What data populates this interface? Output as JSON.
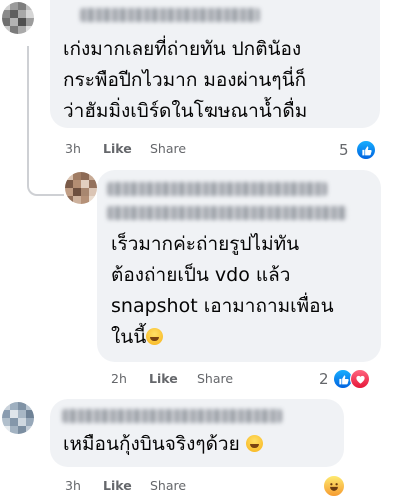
{
  "comments": [
    {
      "text_lines": [
        "เก่งมากเลยที่ถ่ายทัน ปกตินัอง",
        "กระพือปีกไวมาก มองผ่านๆนี่ก็",
        "ว่าฮัมมิ่งเบิร์ดในโฆษณาน้ำดื่ม"
      ],
      "time": "3h",
      "like": "Like",
      "share": "Share",
      "reaction_count": "5",
      "reactions": [
        "like-icon"
      ]
    },
    {
      "text_lines": [
        "เร็วมากค่ะถ่ายรูปไม่ทัน",
        "ต้องถ่ายเป็น vdo แล้ว",
        "snapshot เอามาถามเพื่อน",
        "ในนี้"
      ],
      "time": "2h",
      "like": "Like",
      "share": "Share",
      "reaction_count": "2",
      "reactions": [
        "like-icon",
        "love-icon"
      ]
    },
    {
      "text_lines": [
        "เหมือนกุ้งบินจริงๆด้วย"
      ],
      "time": "3h",
      "like": "Like",
      "share": "Share",
      "reaction_count": "",
      "reactions": [
        "haha-icon"
      ]
    }
  ],
  "colors": {
    "bubble": "#f0f2f5",
    "meta": "#65676b",
    "like_blue": "#1877f2",
    "love_red": "#f33e58",
    "haha_yellow": "#f7b125"
  }
}
